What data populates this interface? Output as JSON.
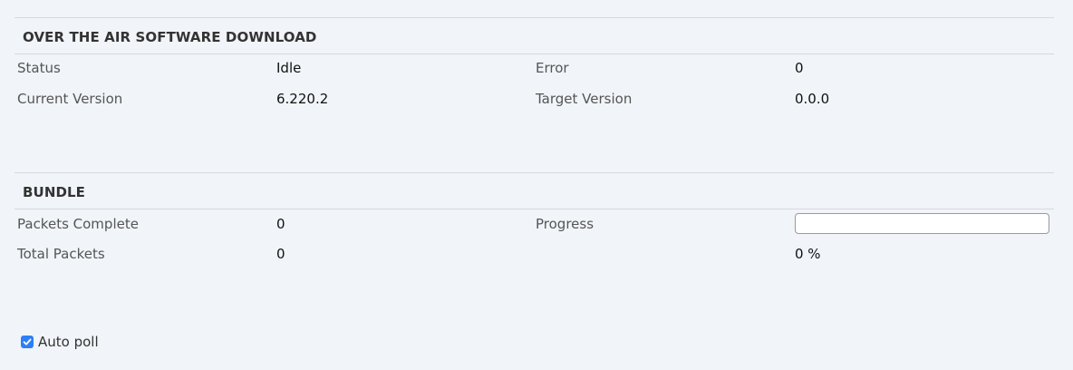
{
  "ota": {
    "heading": "OVER THE AIR SOFTWARE DOWNLOAD",
    "status_label": "Status",
    "status_value": "Idle",
    "error_label": "Error",
    "error_value": "0",
    "current_version_label": "Current Version",
    "current_version_value": "6.220.2",
    "target_version_label": "Target Version",
    "target_version_value": "0.0.0"
  },
  "bundle": {
    "heading": "BUNDLE",
    "packets_complete_label": "Packets Complete",
    "packets_complete_value": "0",
    "total_packets_label": "Total Packets",
    "total_packets_value": "0",
    "progress_label": "Progress",
    "progress_percent_text": "0 %",
    "progress_fraction": 0
  },
  "auto_poll": {
    "label": "Auto poll",
    "checked": true
  },
  "colors": {
    "background": "#f1f4f8",
    "checkbox_accent": "#2d7ff9"
  }
}
